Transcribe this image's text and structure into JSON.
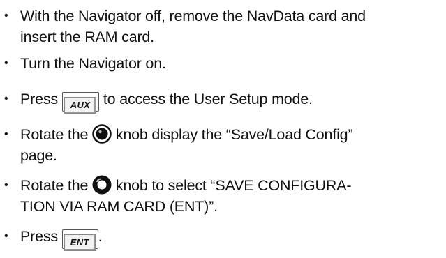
{
  "bullet_glyph": "•",
  "steps": [
    {
      "line1": "With the Navigator off, remove the NavData card and",
      "line2": "insert the RAM card."
    },
    {
      "text": "Turn the Navigator on."
    },
    {
      "before": "Press",
      "key": "AUX",
      "after": "to access the User Setup mode."
    },
    {
      "before": "Rotate the",
      "knob": "inner-knob-icon",
      "after": "knob display the “Save/Load Config”",
      "line2": "page."
    },
    {
      "before": "Rotate the",
      "knob": "outer-knob-icon",
      "after": "knob to select “SAVE CONFIGURA-",
      "line2": "TION VIA RAM CARD (ENT)”."
    },
    {
      "before": "Press",
      "key": "ENT",
      "after": "."
    }
  ]
}
